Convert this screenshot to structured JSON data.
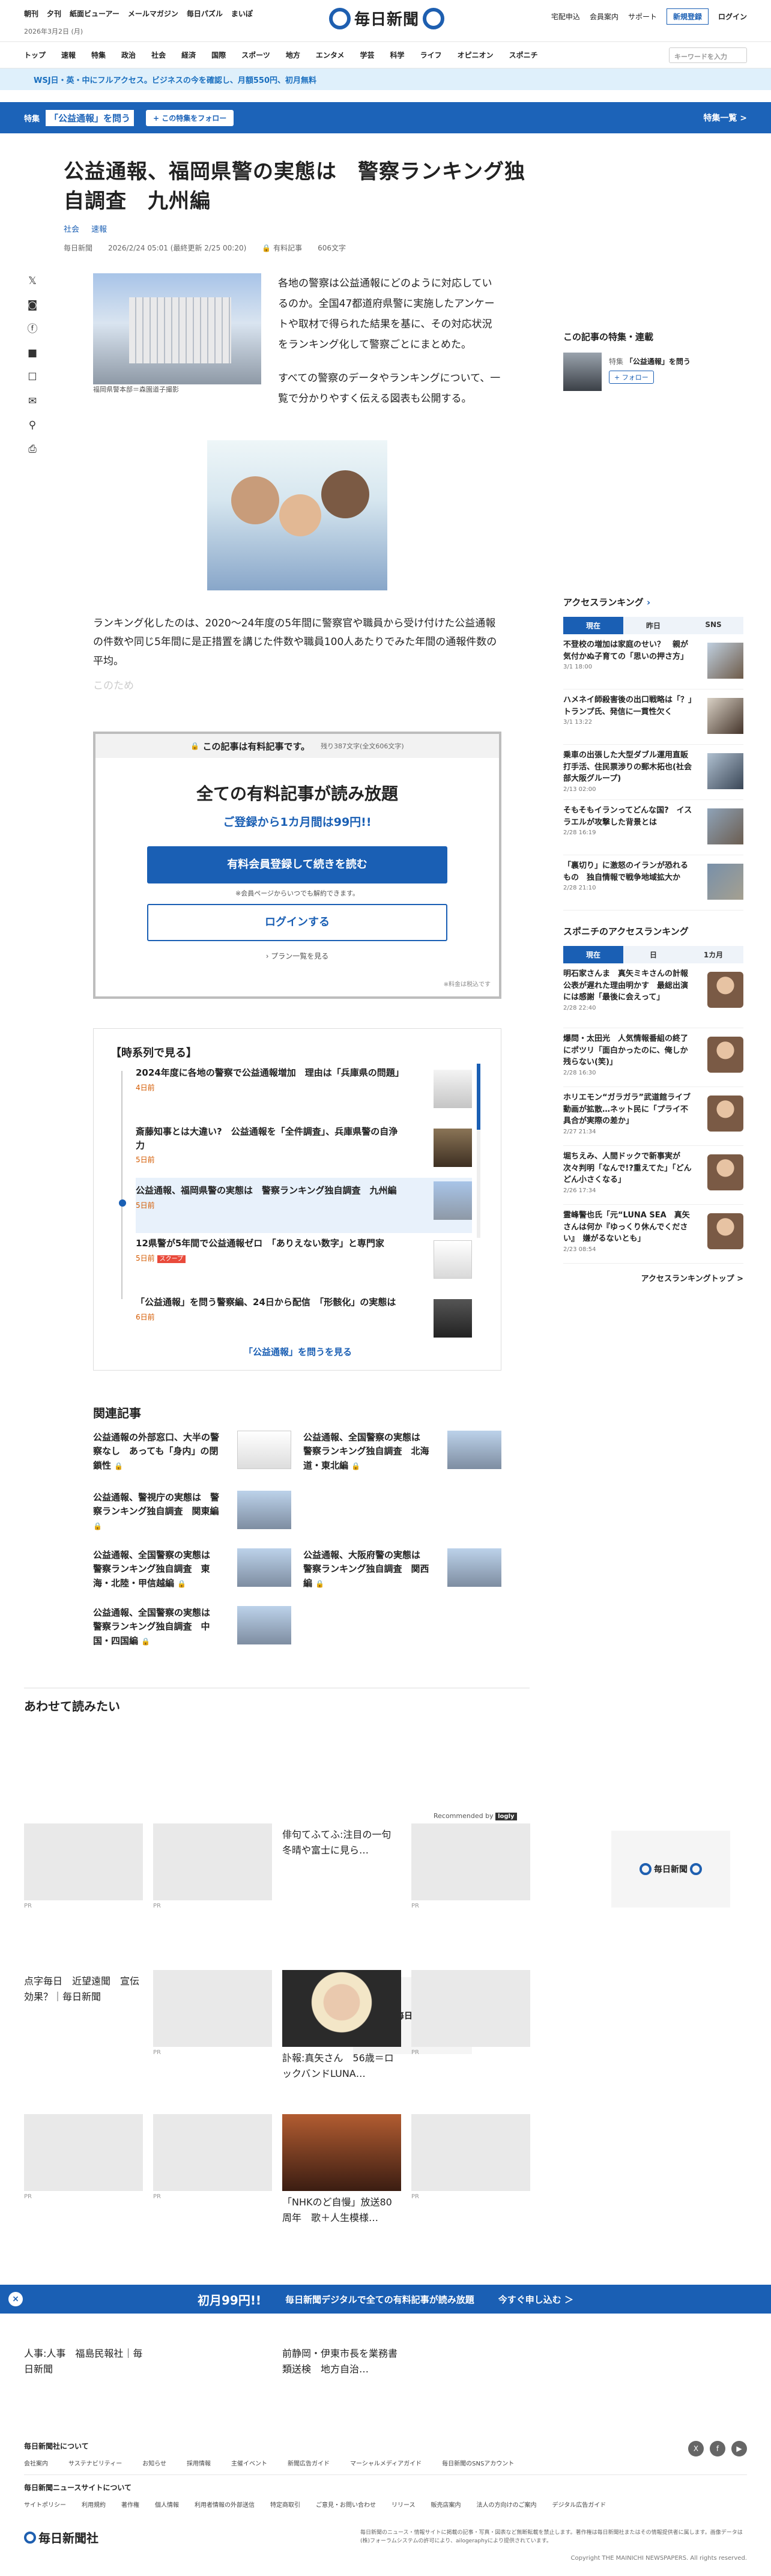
{
  "header": {
    "left_links": [
      "朝刊",
      "夕刊",
      "紙面ビューアー",
      "メールマガジン",
      "毎日パズル",
      "まいぽ"
    ],
    "date": "2026年3月2日 (月)",
    "logo": "毎日新聞",
    "right_links": [
      "宅配申込",
      "会員案内",
      "サポート"
    ],
    "register": "新規登録",
    "login": "ログイン"
  },
  "nav": {
    "items": [
      "トップ",
      "速報",
      "特集",
      "政治",
      "社会",
      "経済",
      "国際",
      "スポーツ",
      "地方",
      "エンタメ",
      "学芸",
      "科学",
      "ライフ",
      "オピニオン",
      "スポニチ"
    ],
    "search_placeholder": "キーワードを入力"
  },
  "promo": "WSJ日・英・中にフルアクセス。ビジネスの今を確認し、月額550円、初月無料",
  "feature": {
    "tag": "特集",
    "title": "「公益通報」を問う",
    "follow": "+ この特集をフォロー",
    "list": "特集一覧 >"
  },
  "article": {
    "title": "公益通報、福岡県警の実態は　警察ランキング独自調査　九州編",
    "tags": [
      "社会",
      "速報"
    ],
    "source": "毎日新聞",
    "date": "2026/2/24 05:01 (最終更新 2/25 00:20)",
    "paid": "有料記事",
    "chars": "606文字",
    "caption": "福岡県警本部＝森園道子撮影",
    "p1": "各地の警察は公益通報にどのように対応しているのか。全国47都道府県警に実施したアンケートや取材で得られた結果を基に、その対応状況をランキング化して警察ごとにまとめた。",
    "p2": "すべての警察のデータやランキングについて、一覧で分かりやすく伝える図表も公開する。",
    "p3": "ランキング化したのは、2020～24年度の5年間に警察官や職員から受け付けた公益通報の件数や同じ5年間に是正措置を講じた件数や職員100人あたりでみた年間の通報件数の平均。",
    "fade": "このため"
  },
  "paywall": {
    "notice": "この記事は有料記事です。",
    "rest": "残り387文字(全文606文字)",
    "headline": "全ての有料記事が読み放題",
    "sub": "ご登録から1カ月間は99円!!",
    "cta": "有料会員登録して続きを読む",
    "note": "※会員ページからいつでも解約できます。",
    "login": "ログインする",
    "plans": "› プラン一覧を見る",
    "tax": "※料金は税込です"
  },
  "series": {
    "title": "【時系列で見る】",
    "items": [
      {
        "title": "2024年度に各地の警察で公益通報増加　理由は「兵庫県の問題」",
        "date": "4日前",
        "new": ""
      },
      {
        "title": "斎藤知事とは大違い?　公益通報を「全件調査」、兵庫県警の自浄力",
        "date": "5日前",
        "new": ""
      },
      {
        "title": "公益通報、福岡県警の実態は　警察ランキング独自調査　九州編",
        "date": "5日前",
        "new": ""
      },
      {
        "title": "12県警が5年間で公益通報ゼロ　「ありえない数字」と専門家",
        "date": "5日前",
        "new": "スクープ"
      },
      {
        "title": "「公益通報」を問う警察編、24日から配信　「形骸化」の実態は",
        "date": "6日前",
        "new": ""
      }
    ],
    "more": "「公益通報」を問うを見る"
  },
  "related": {
    "heading": "関連記事",
    "items": [
      "公益通報の外部窓口、大半の警察なし　あっても「身内」の閉鎖性",
      "公益通報、全国警察の実態は　警察ランキング独自調査　北海道・東北編",
      "公益通報、警視庁の実態は　警察ランキング独自調査　関東編",
      "公益通報、全国警察の実態は　警察ランキング独自調査　東海・北陸・甲信越編",
      "公益通報、大阪府警の実態は　警察ランキング独自調査　関西編",
      "公益通報、全国警察の実態は　警察ランキング独自調査　中国・四国編"
    ]
  },
  "rail": {
    "series_box": {
      "heading": "この記事の特集・連載",
      "tag": "特集",
      "title": "「公益通報」を問う",
      "follow": "+ フォロー"
    },
    "access": {
      "heading": "アクセスランキング",
      "tabs": [
        "現在",
        "昨日",
        "SNS"
      ],
      "items": [
        {
          "title": "不登校の増加は家庭のせい？　親が気付かぬ子育ての「思いの押さ方」",
          "date": "3/1 18:00"
        },
        {
          "title": "ハメネイ師殺害後の出口戦略は「？」　トランプ氏、発信に一貫性欠く",
          "date": "3/1 13:22"
        },
        {
          "title": "乗車の出張した大型ダブル運用直販打手活、住民票渉りの郵木拓也(社会部大阪グループ)",
          "date": "2/13 02:00"
        },
        {
          "title": "そもそもイランってどんな国?　イスラエルが攻撃した背景とは",
          "date": "2/28 16:19"
        },
        {
          "title": "「裏切り」に激怒のイランが恐れるもの　独自情報で戦争地域拡大か",
          "date": "2/28 21:10"
        }
      ]
    },
    "sponichi": {
      "heading": "スポニチのアクセスランキング",
      "tabs": [
        "現在",
        "日",
        "1カ月"
      ],
      "items": [
        {
          "title": "明石家さんま　真矢ミキさんの計報公表が遅れた理由明かす　最総出演には感謝「最後に会えって」",
          "date": "2/28 22:40"
        },
        {
          "title": "爆問・太田光　人気情報番組の終了にポツリ「面白かったのに、俺しか残らない(笑)」",
          "date": "2/28 16:30"
        },
        {
          "title": "ホリエモン“ガラガラ”武道館ライブ動画が拡散…ネット民に「プライ不具合が実際の差か」",
          "date": "2/27 21:34"
        },
        {
          "title": "堀ちえみ、人間ドックで新事実が次々判明「なんで!?重えてた」「どんどん小さくなる」",
          "date": "2/26 17:34"
        },
        {
          "title": "霊峰警也氏「元“LUNA SEA　真矢さんは何か『ゆっくり休んでください』　嫌がるないとも」",
          "date": "2/23 08:54"
        }
      ],
      "foot": "アクセスランキングトップ >"
    }
  },
  "readtoo": {
    "heading": "あわせて読みたい",
    "recommended": "Recommended by",
    "recommended_brand": "logly",
    "cards": [
      {
        "title": "",
        "pr": "PR"
      },
      {
        "title": "",
        "pr": "PR"
      },
      {
        "title": "俳句てふてふ:注目の一句　冬晴や富士に見ら…",
        "pr": ""
      },
      {
        "title": "",
        "pr": "PR"
      },
      {
        "title": "点字毎日　近望遠聞　宣伝効果？｜毎日新聞",
        "pr": ""
      },
      {
        "title": "",
        "pr": "PR"
      },
      {
        "title": "訃報:真矢さん　56歳＝ロックバンドLUNA…",
        "pr": ""
      },
      {
        "title": "",
        "pr": "PR"
      },
      {
        "title": "",
        "pr": "PR"
      },
      {
        "title": "",
        "pr": "PR"
      },
      {
        "title": "「NHKのど自慢」放送80周年　歌＋人生模様…",
        "pr": ""
      },
      {
        "title": "",
        "pr": "PR"
      },
      {
        "title": "人事:人事　福島民報社｜毎日新聞",
        "pr": ""
      },
      {
        "title": "前静岡・伊東市長を業務書類送検　地方自治…",
        "pr": ""
      }
    ]
  },
  "sticky": {
    "close": "×",
    "big": "初月99円!!",
    "mid": "毎日新聞デジタルで全ての有料記事が読み放題",
    "btn": "今すぐ申し込む ＞"
  },
  "footer": {
    "about": "毎日新聞社について",
    "about_links": [
      "会社案内",
      "サステナビリティー",
      "お知らせ",
      "採用情報",
      "主催イベント",
      "新聞広告ガイド",
      "マーシャルメディアガイド",
      "毎日新聞のSNSアカウント"
    ],
    "sites": "毎日新聞ニュースサイトについて",
    "site_links": [
      "サイトポリシー",
      "利用規約",
      "著作権",
      "個人情報",
      "利用者情報の外部送信",
      "特定商取引",
      "ご意見・お問い合わせ",
      "リリース",
      "販売店案内",
      "法人の方向けのご案内",
      "デジタル広告ガイド"
    ],
    "social": [
      "X",
      "f",
      "▶"
    ],
    "logo": "毎日新聞社",
    "note": "毎日新聞のニュース・情報サイトに掲載の記事・写真・図表など無断転載を禁止します。著作権は毎日新聞社またはその情報提供者に属します。画像データは(株)フォーラムシステムの許可により、ailogeraphyにより提供されています。",
    "copy": "Copyright THE MAINICHI NEWSPAPERS. All rights reserved."
  }
}
